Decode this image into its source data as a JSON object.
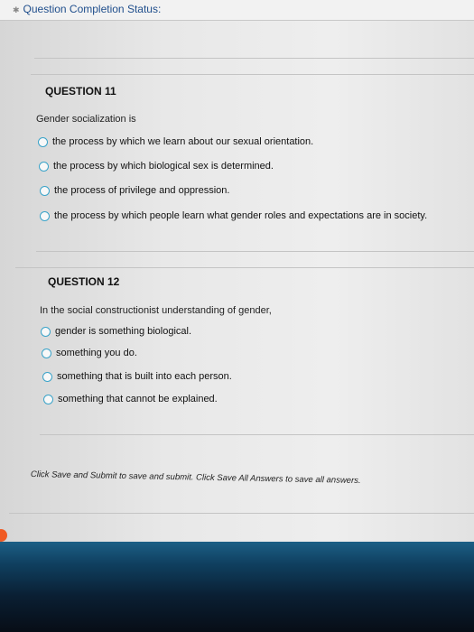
{
  "status": {
    "label": "Question Completion Status:"
  },
  "questions": [
    {
      "title": "QUESTION 11",
      "prompt": "Gender socialization is",
      "options": [
        "the process by which we learn about our sexual orientation.",
        "the process by which biological sex is determined.",
        "the process of privilege and oppression.",
        "the process by which people learn what gender roles and expectations are in society."
      ]
    },
    {
      "title": "QUESTION 12",
      "prompt": "In the social constructionist understanding of gender,",
      "options": [
        "gender is something biological.",
        "something you do.",
        "something that is built into each person.",
        "something that cannot be explained."
      ]
    }
  ],
  "footer": {
    "note": "Click Save and Submit to save and submit. Click Save All Answers to save all answers."
  },
  "colors": {
    "accent": "#3aa3c9",
    "link": "#1f4e8c",
    "orange": "#f05a23"
  }
}
